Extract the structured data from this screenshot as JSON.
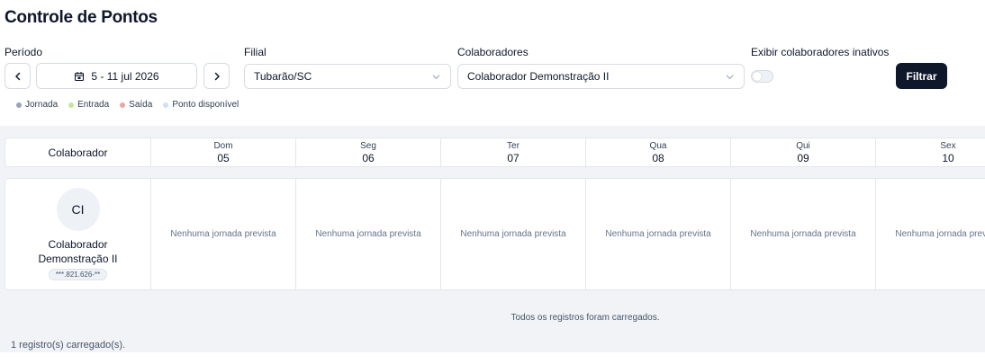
{
  "page": {
    "title": "Controle de Pontos"
  },
  "filters": {
    "period_label": "Período",
    "period_value": "5 - 11 jul 2026",
    "branch_label": "Filial",
    "branch_value": "Tubarão/SC",
    "employees_label": "Colaboradores",
    "employees_value": "Colaborador Demonstração II",
    "inactive_label": "Exibir colaboradores inativos",
    "inactive_on": false,
    "filter_button": "Filtrar"
  },
  "legend": [
    {
      "label": "Jornada",
      "color": "#9aa3b2"
    },
    {
      "label": "Entrada",
      "color": "#c9e3a6"
    },
    {
      "label": "Saída",
      "color": "#e9a9a0"
    },
    {
      "label": "Ponto disponível",
      "color": "#cfe0f0"
    }
  ],
  "table": {
    "first_header": "Colaborador",
    "days": [
      {
        "name": "Dom",
        "date": "05"
      },
      {
        "name": "Seg",
        "date": "06"
      },
      {
        "name": "Ter",
        "date": "07"
      },
      {
        "name": "Qua",
        "date": "08"
      },
      {
        "name": "Qui",
        "date": "09"
      },
      {
        "name": "Sex",
        "date": "10"
      }
    ],
    "employee": {
      "initials": "CI",
      "name": "Colaborador Demonstração II",
      "doc": "***.821.626-**"
    },
    "empty_cell_text": "Nenhuma jornada prevista"
  },
  "footer": {
    "loaded_message": "Todos os registros foram carregados.",
    "count_message": "1 registro(s) carregado(s)."
  },
  "colors": {
    "primary": "#0f172a",
    "panel_bg": "#f1f3f6",
    "border": "#e2e6ec"
  }
}
